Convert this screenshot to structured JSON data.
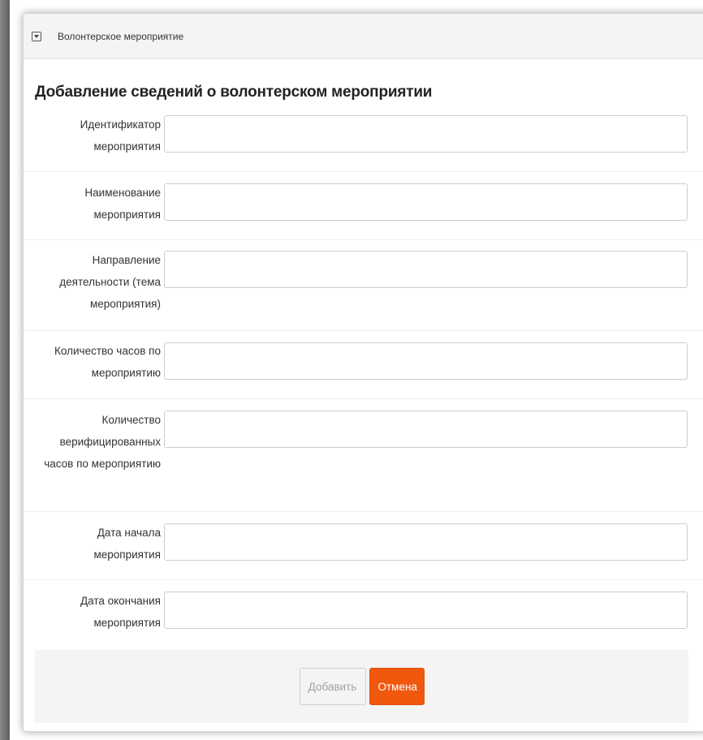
{
  "panel": {
    "title": "Волонтерское мероприятие"
  },
  "form": {
    "title": "Добавление сведений о волонтерском мероприятии",
    "fields": [
      {
        "label": "Идентификатор мероприятия",
        "value": ""
      },
      {
        "label": "Наименование мероприятия",
        "value": ""
      },
      {
        "label": "Направление деятельности (тема мероприятия)",
        "value": ""
      },
      {
        "label": "Количество часов по мероприятию",
        "value": ""
      },
      {
        "label": "Количество верифицированных часов по мероприятию",
        "value": ""
      },
      {
        "label": "Дата начала мероприятия",
        "value": ""
      },
      {
        "label": "Дата окончания мероприятия",
        "value": ""
      }
    ]
  },
  "buttons": {
    "add_label": "Добавить",
    "cancel_label": "Отмена"
  },
  "colors": {
    "accent": "#f0580e",
    "header_bg": "#f4f4f4"
  },
  "icons": {
    "collapse": "collapse-toggle-icon"
  }
}
